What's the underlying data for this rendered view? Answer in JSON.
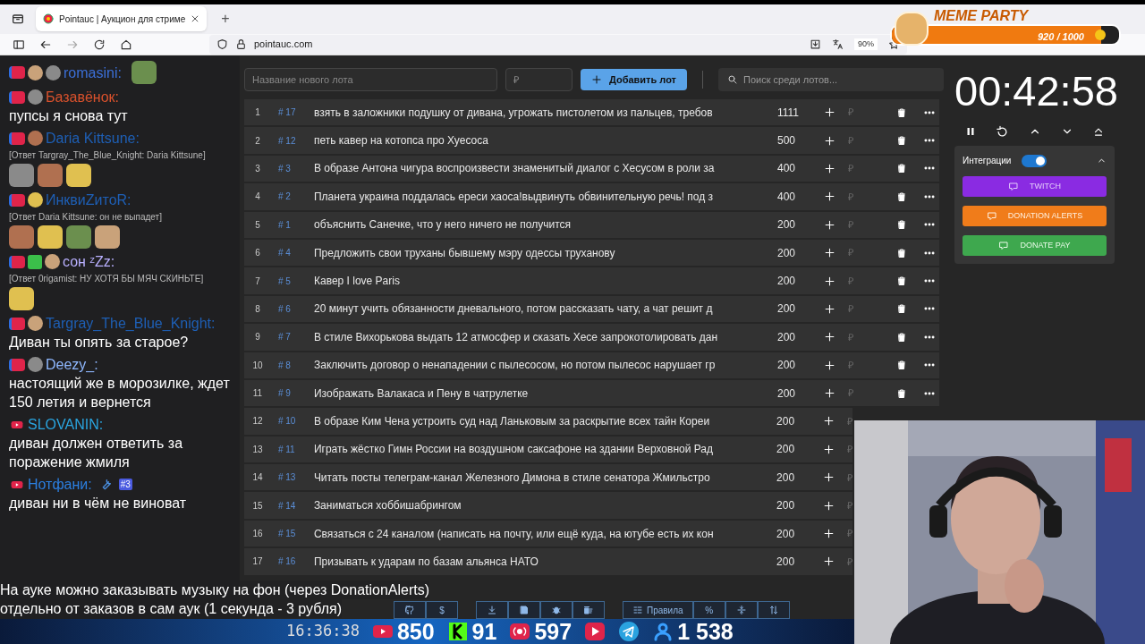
{
  "browser": {
    "tabs": [
      {
        "label": "Pointauc | Аукцион для стриме",
        "selected": true
      }
    ],
    "new_tab": "+",
    "url": "pointauc.com",
    "zoom": "90%"
  },
  "meme_party": {
    "title": "MEME PARTY",
    "count": "920 / 1000",
    "level": 0.92
  },
  "chat": [
    {
      "badges": [
        {
          "kind": "live"
        },
        {
          "kind": "emote"
        },
        {
          "kind": "emote"
        }
      ],
      "name": "romasini:",
      "color": "#3b6fd8",
      "emotes": [
        {
          "kind": "emote"
        }
      ]
    },
    {
      "badges": [
        {
          "kind": "live"
        },
        {
          "kind": "emote"
        }
      ],
      "name": "Базавёнок:",
      "color": "#d9512c",
      "text": "пупсы я снова тут"
    },
    {
      "badges": [
        {
          "kind": "live"
        },
        {
          "kind": "emote"
        }
      ],
      "name": "Daria Kittsune:",
      "color": "#1e5fb5",
      "reply": "[Ответ Targray_The_Blue_Knight: Daria Kittsune]",
      "emotes": [
        {
          "kind": "emote"
        },
        {
          "kind": "emote"
        },
        {
          "kind": "emote"
        }
      ]
    },
    {
      "badges": [
        {
          "kind": "live"
        },
        {
          "kind": "emote"
        }
      ],
      "name": "ИнквиZитоR:",
      "color": "#1e5fb5",
      "reply": "[Ответ Daria Kittsune: он не выпадет]",
      "emotes": [
        {
          "kind": "emote"
        },
        {
          "kind": "emote"
        },
        {
          "kind": "emote"
        },
        {
          "kind": "emote"
        }
      ]
    },
    {
      "badges": [
        {
          "kind": "live"
        },
        {
          "kind": "sub"
        },
        {
          "kind": "emote"
        }
      ],
      "name": "сон ᶻZz:",
      "color": "#b9b0ff",
      "reply": "[Ответ 0rigamist: НУ ХОТЯ БЫ МЯЧ СКИНЬТЕ]",
      "emotes": [
        {
          "kind": "emote"
        }
      ]
    },
    {
      "badges": [
        {
          "kind": "live"
        },
        {
          "kind": "emote"
        }
      ],
      "name": "Targray_The_Blue_Knight:",
      "color": "#1e5fb5",
      "text": "Диван ты опять за старое?"
    },
    {
      "badges": [
        {
          "kind": "live"
        },
        {
          "kind": "emote"
        }
      ],
      "name": "Deezy_:",
      "color": "#8fb8ff",
      "text": "настоящий же в морозилке, ждет 150 летия и вернется"
    },
    {
      "badges": [
        {
          "kind": "youtube"
        }
      ],
      "name": "SLOVANIN:",
      "color": "#2aa5e0",
      "text": "диван должен ответить за поражение жмиля"
    },
    {
      "badges": [
        {
          "kind": "youtube"
        }
      ],
      "name": "Нотфани:",
      "color": "#2b7fe0",
      "tag": "#3",
      "text": "диван ни в чём не виноват"
    }
  ],
  "form": {
    "name_placeholder": "Название нового лота",
    "amount_placeholder": "₽",
    "add_button": "Добавить лот",
    "search_placeholder": "Поиск среди лотов..."
  },
  "lots": [
    {
      "index": "1",
      "id": "# 17",
      "title": "взять в заложники подушку от дивана, угрожать пистолетом из пальцев, требов",
      "amount": "1111",
      "covered": false
    },
    {
      "index": "2",
      "id": "# 12",
      "title": "петь кавер на котопса про Хуесоса",
      "amount": "500",
      "covered": false
    },
    {
      "index": "3",
      "id": "# 3",
      "title": "В образе Антона чигура воспроизвести знаменитый диалог с Хесусом в роли за",
      "amount": "400",
      "covered": false
    },
    {
      "index": "4",
      "id": "# 2",
      "title": "Планета украина поддалась ереси хаоса!выдвинуть обвинительную речь! под з",
      "amount": "400",
      "covered": false
    },
    {
      "index": "5",
      "id": "# 1",
      "title": "объяснить Санечке, что у него ничего не получится",
      "amount": "200",
      "covered": false
    },
    {
      "index": "6",
      "id": "# 4",
      "title": "Предложить свои труханы бывшему мэру одессы труханову",
      "amount": "200",
      "covered": false
    },
    {
      "index": "7",
      "id": "# 5",
      "title": "Кавер I love Paris",
      "amount": "200",
      "covered": false
    },
    {
      "index": "8",
      "id": "# 6",
      "title": "20 минут учить обязанности дневального, потом рассказать чату, а чат решит д",
      "amount": "200",
      "covered": false
    },
    {
      "index": "9",
      "id": "# 7",
      "title": "В стиле Вихорькова выдать 12 атмосфер и сказать Хесе запрокотолировать дан",
      "amount": "200",
      "covered": false
    },
    {
      "index": "10",
      "id": "# 8",
      "title": "Заключить договор о ненападении с пылесосом, но потом пылесос нарушает гр",
      "amount": "200",
      "covered": false
    },
    {
      "index": "11",
      "id": "# 9",
      "title": "Изображать Валакаса и Пену в чатрулетке",
      "amount": "200",
      "covered": false
    },
    {
      "index": "12",
      "id": "# 10",
      "title": "В образе Ким Чена устроить суд над Ланьковым за раскрытие всех тайн Кореи",
      "amount": "200",
      "covered": true
    },
    {
      "index": "13",
      "id": "# 11",
      "title": "Играть жёстко Гимн России на воздушном саксафоне на здании Верховной Рад",
      "amount": "200",
      "covered": true
    },
    {
      "index": "14",
      "id": "# 13",
      "title": "Читать посты телеграм-канал Железного Димона в стиле сенатора Жмильстро",
      "amount": "200",
      "covered": true
    },
    {
      "index": "15",
      "id": "# 14",
      "title": "Заниматься хоббишабрингом",
      "amount": "200",
      "covered": true
    },
    {
      "index": "16",
      "id": "# 15",
      "title": "Связаться с 24 каналом (написать на почту, или ещё куда, на ютубе есть их кон",
      "amount": "200",
      "covered": true
    },
    {
      "index": "17",
      "id": "# 16",
      "title": "Призывать к ударам по базам альянса НАТО",
      "amount": "200",
      "covered": true
    }
  ],
  "timer": {
    "time": "00:42:58"
  },
  "integrations": {
    "label": "Интеграции",
    "on": true,
    "buttons": [
      {
        "kind": "twitch",
        "label": "TWITCH"
      },
      {
        "kind": "donationalerts",
        "label": "DONATION ALERTS"
      },
      {
        "kind": "donatepay",
        "label": "DONATE PAY"
      }
    ]
  },
  "toolbar": [
    {
      "kind": "github"
    },
    {
      "kind": "dollar",
      "label": "$"
    },
    {
      "kind": "download"
    },
    {
      "kind": "save"
    },
    {
      "kind": "bug"
    },
    {
      "kind": "clear"
    },
    {
      "kind": "rules",
      "label": "Правила"
    },
    {
      "kind": "percent",
      "label": "%"
    },
    {
      "kind": "split"
    },
    {
      "kind": "sort"
    }
  ],
  "subtitle_lines": [
    "На ауке можно заказывать музыку на фон (через DonationAlerts)",
    "отдельно от заказов в сам аук (1 секунда - 3 рубля)"
  ],
  "stream_bar": {
    "clock": "16:36:38",
    "stats": [
      {
        "kind": "youtube",
        "value": "850"
      },
      {
        "kind": "kick",
        "value": "91"
      },
      {
        "kind": "live",
        "value": "597"
      },
      {
        "kind": "rutube"
      },
      {
        "kind": "telegram"
      },
      {
        "kind": "viewers",
        "value": "1 538"
      }
    ]
  }
}
